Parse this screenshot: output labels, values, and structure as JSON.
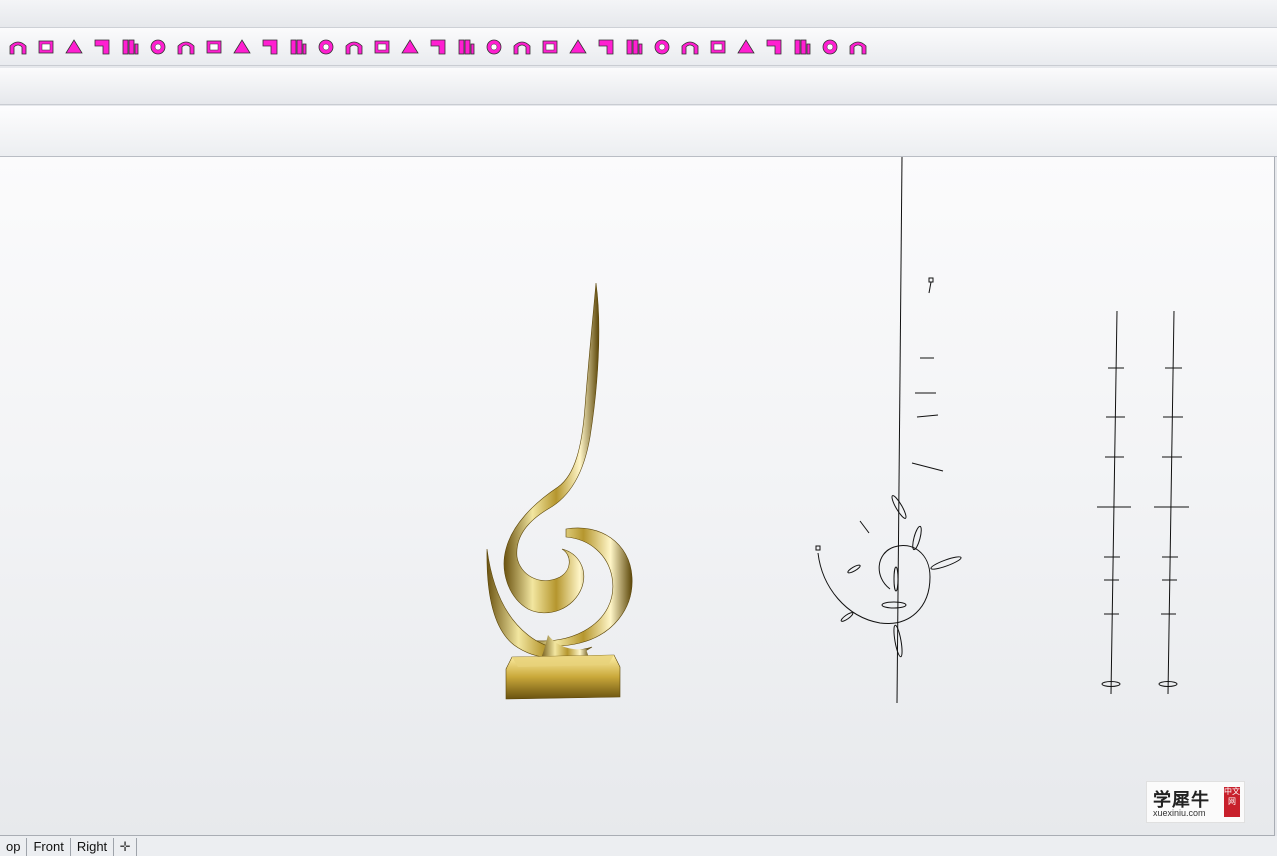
{
  "toolbar": {
    "tools": [
      "partial-arch-icon",
      "arch-icon",
      "cut-solid-icon",
      "fold-edge-icon",
      "box-cube-icon",
      "box-cube-alt-icon",
      "wall-solid-icon",
      "wall-solid-2-icon",
      "wall-solid-3-icon",
      "wall-solid-4-icon",
      "check-frame-icon",
      "cylinder-arrows-icon",
      "grid-delete-icon",
      "grid-icon",
      "stack-cube-icon",
      "rail-revolve-icon",
      "sweep-icon",
      "fold-arrow-icon",
      "patch-surface-icon",
      "extrude-curves-icon",
      "flag-surface-icon",
      "split-x-icon",
      "solid-cube-icon",
      "trim-point-icon",
      "branch-icon",
      "star-rotate-icon",
      "target-icon",
      "blend-petal-icon",
      "layer-stack-icon",
      "network-curve-icon",
      "gear-icon"
    ],
    "accent_color": "#ff1fd1"
  },
  "viewport": {
    "background_top": "#fbfbfc",
    "background_bottom": "#e7e9ec",
    "trophy_color": "#b89a2e"
  },
  "tabs": {
    "items": [
      "op",
      "Front",
      "Right"
    ],
    "add_icon": "plus-icon"
  },
  "watermark": {
    "main": "学犀牛",
    "url": "xuexiniu.com",
    "seal": "中文网"
  }
}
